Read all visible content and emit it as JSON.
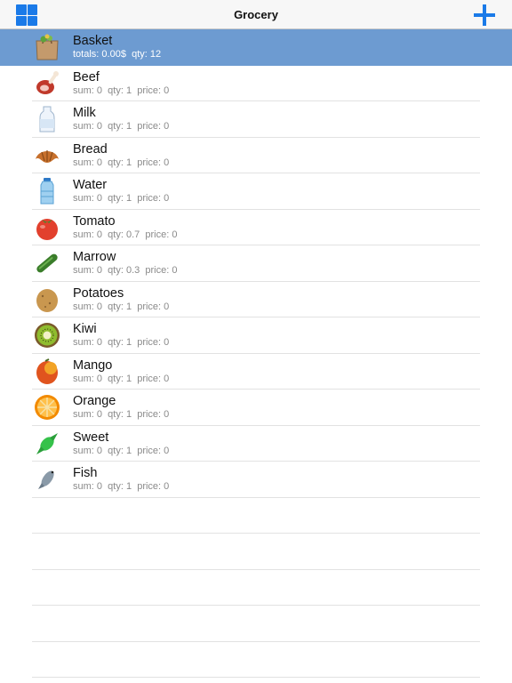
{
  "navbar": {
    "title": "Grocery",
    "left_icon": "grid-icon",
    "right_icon": "plus-icon",
    "accent": "#1a7ae8"
  },
  "basket": {
    "name": "Basket",
    "totals_label": "totals:",
    "totals_value": "0.00$",
    "qty_label": "qty:",
    "qty_value": "12",
    "icon": "basket-bag-icon",
    "highlight_color": "#6d9bd1"
  },
  "items": [
    {
      "name": "Beef",
      "sum": "0",
      "qty": "1",
      "price": "0",
      "icon": "beef-icon"
    },
    {
      "name": "Milk",
      "sum": "0",
      "qty": "1",
      "price": "0",
      "icon": "milk-bottle-icon"
    },
    {
      "name": "Bread",
      "sum": "0",
      "qty": "1",
      "price": "0",
      "icon": "croissant-icon"
    },
    {
      "name": "Water",
      "sum": "0",
      "qty": "1",
      "price": "0",
      "icon": "water-jug-icon"
    },
    {
      "name": "Tomato",
      "sum": "0",
      "qty": "0.7",
      "price": "0",
      "icon": "tomato-icon"
    },
    {
      "name": "Marrow",
      "sum": "0",
      "qty": "0.3",
      "price": "0",
      "icon": "cucumber-icon"
    },
    {
      "name": "Potatoes",
      "sum": "0",
      "qty": "1",
      "price": "0",
      "icon": "potato-icon"
    },
    {
      "name": "Kiwi",
      "sum": "0",
      "qty": "1",
      "price": "0",
      "icon": "kiwi-icon"
    },
    {
      "name": "Mango",
      "sum": "0",
      "qty": "1",
      "price": "0",
      "icon": "mango-icon"
    },
    {
      "name": "Orange",
      "sum": "0",
      "qty": "1",
      "price": "0",
      "icon": "orange-icon"
    },
    {
      "name": "Sweet",
      "sum": "0",
      "qty": "1",
      "price": "0",
      "icon": "candy-icon"
    },
    {
      "name": "Fish",
      "sum": "0",
      "qty": "1",
      "price": "0",
      "icon": "fish-icon"
    }
  ],
  "labels": {
    "sum": "sum:",
    "qty": "qty:",
    "price": "price:"
  }
}
